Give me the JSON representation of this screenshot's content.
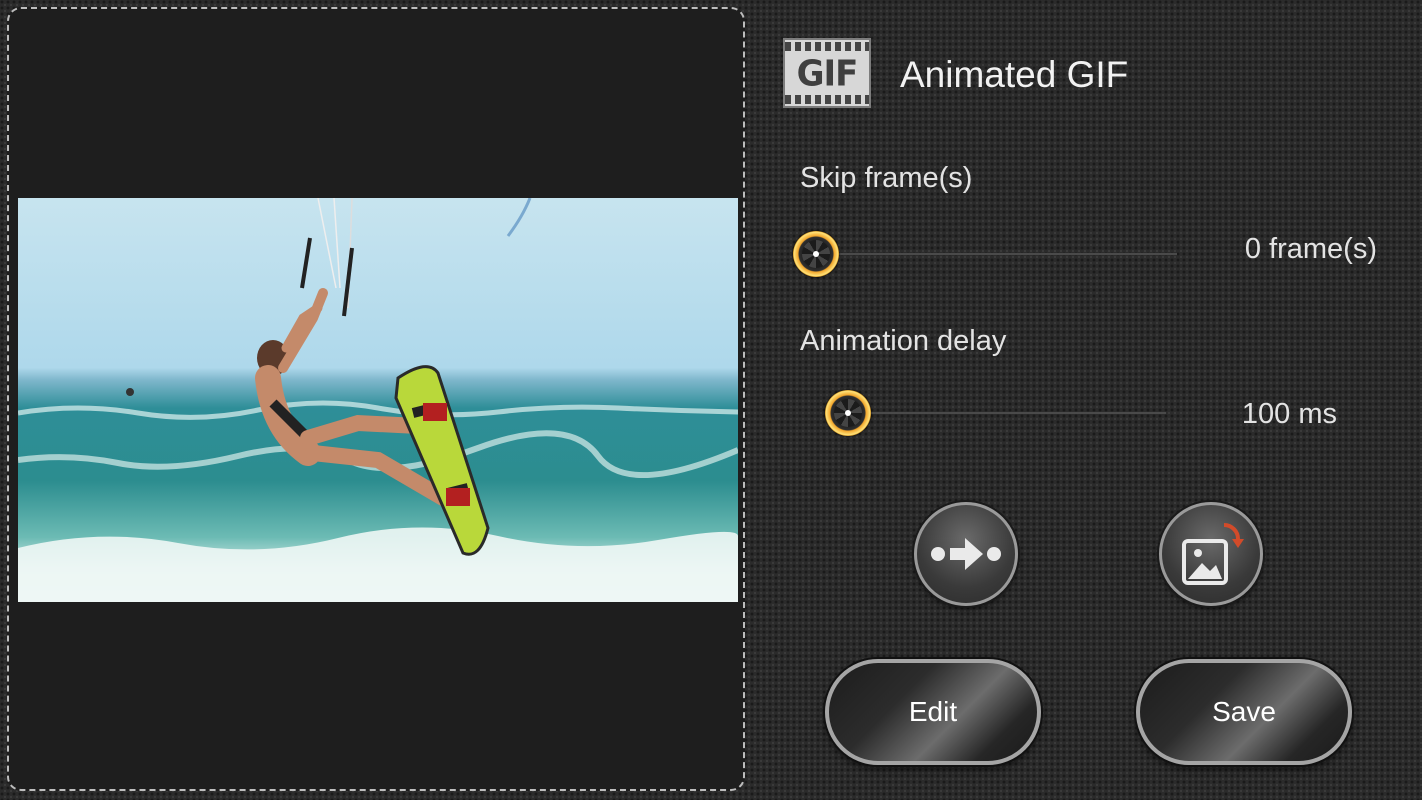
{
  "header": {
    "icon_text": "GIF",
    "title": "Animated GIF"
  },
  "skip_frames": {
    "label": "Skip frame(s)",
    "value_text": "0 frame(s)",
    "value": 0
  },
  "animation_delay": {
    "label": "Animation delay",
    "value_text": "100 ms",
    "value": 100
  },
  "icons": {
    "sequence": "arrow-between-dots-icon",
    "image_rotate": "image-rotate-icon",
    "header": "gif-film-icon"
  },
  "buttons": {
    "edit": "Edit",
    "save": "Save"
  },
  "colors": {
    "knob_ring": "#f3a62b",
    "background": "#2b2b2b"
  }
}
